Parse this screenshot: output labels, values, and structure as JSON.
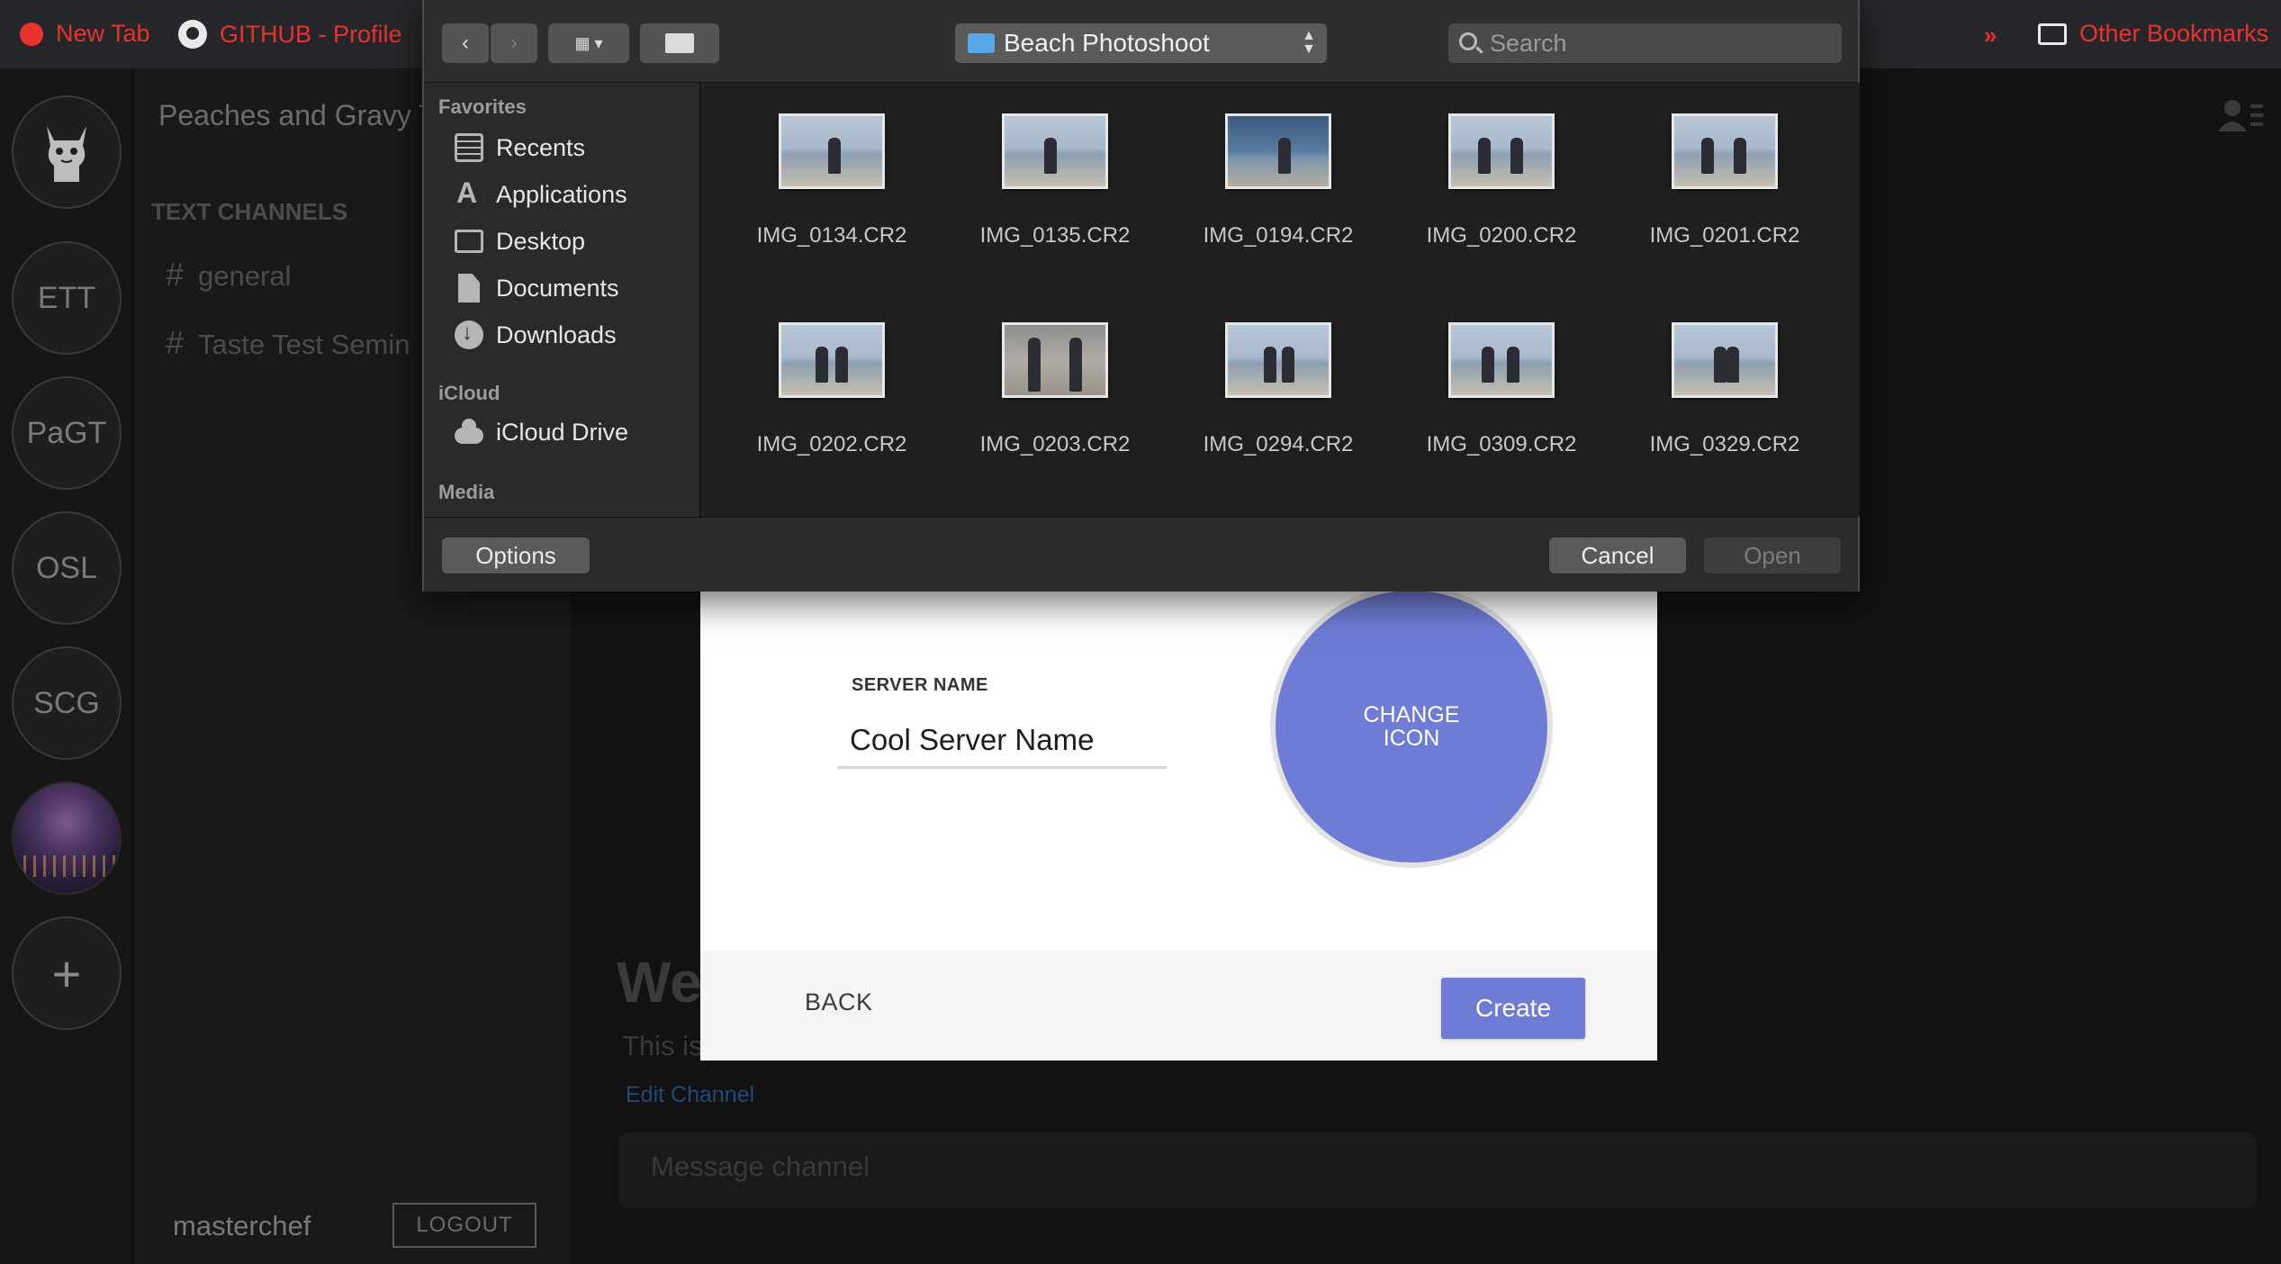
{
  "browser": {
    "bookmarks": [
      {
        "label": "New Tab"
      },
      {
        "label": "GITHUB - Profile"
      }
    ],
    "overflow": "»",
    "other_bookmarks": "Other Bookmarks"
  },
  "servers": [
    "ETT",
    "PaGT",
    "OSL",
    "SCG"
  ],
  "add_server": "+",
  "channels_panel": {
    "server_title": "Peaches and Gravy T",
    "section": "TEXT CHANNELS",
    "channels": [
      "general",
      "Taste Test Semin"
    ],
    "username": "masterchef",
    "logout": "LOGOUT"
  },
  "main": {
    "welcome": "We",
    "description": "This is",
    "edit_channel": "Edit Channel",
    "message_placeholder": "Message channel"
  },
  "create_server_modal": {
    "server_name_label": "SERVER NAME",
    "server_name_value": "Cool Server Name",
    "change_icon": "CHANGE ICON",
    "back": "BACK",
    "create": "Create",
    "accent_color": "#6f7cd5"
  },
  "file_dialog": {
    "location": "Beach Photoshoot",
    "search_placeholder": "Search",
    "sidebar": {
      "favorites_heading": "Favorites",
      "favorites": [
        {
          "label": "Recents",
          "icon": "recents-icon"
        },
        {
          "label": "Applications",
          "icon": "applications-icon"
        },
        {
          "label": "Desktop",
          "icon": "desktop-icon"
        },
        {
          "label": "Documents",
          "icon": "documents-icon"
        },
        {
          "label": "Downloads",
          "icon": "downloads-icon"
        }
      ],
      "icloud_heading": "iCloud",
      "icloud": [
        {
          "label": "iCloud Drive",
          "icon": "cloud-icon"
        }
      ],
      "media_heading": "Media"
    },
    "files": [
      "IMG_0134.CR2",
      "IMG_0135.CR2",
      "IMG_0194.CR2",
      "IMG_0200.CR2",
      "IMG_0201.CR2",
      "IMG_0202.CR2",
      "IMG_0203.CR2",
      "IMG_0294.CR2",
      "IMG_0309.CR2",
      "IMG_0329.CR2"
    ],
    "buttons": {
      "options": "Options",
      "cancel": "Cancel",
      "open": "Open"
    }
  }
}
